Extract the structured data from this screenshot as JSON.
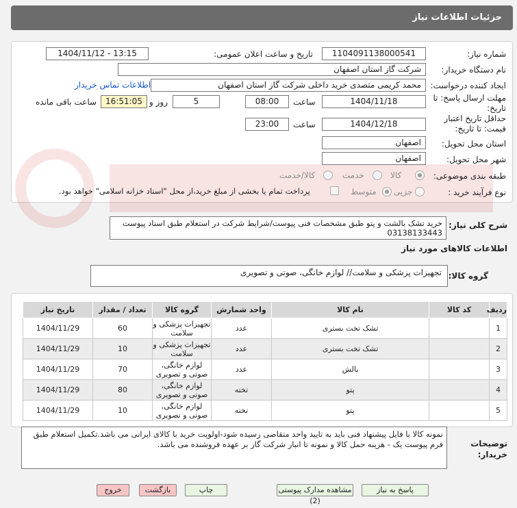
{
  "header": {
    "title": "جزئیات اطلاعات نیاز"
  },
  "form": {
    "need_number_label": "شماره نیاز:",
    "need_number": "1104091138000541",
    "announce_label": "تاریخ و ساعت اعلان عمومی:",
    "announce_value": "1404/11/12 - 13:15",
    "buyer_org_label": "نام دستگاه خریدار:",
    "buyer_org": "شرکت گاز استان اصفهان",
    "creator_label": "ایجاد کننده درخواست:",
    "creator": "محمد کریمی متصدی خرید داخلی شرکت گاز استان اصفهان",
    "contact_link": "اطلاعات تماس خریدار",
    "deadline_label": "مهلت ارسال پاسخ: تا تاریخ:",
    "deadline_date": "1404/11/18",
    "time_label": "ساعت",
    "deadline_time": "08:00",
    "days": "5",
    "days_label": "روز و",
    "remaining_time": "16:51:05",
    "remaining_label": "ساعت باقی مانده",
    "min_validity_label": "حداقل تاریخ اعتبار قیمت: تا تاریخ:",
    "validity_date": "1404/12/18",
    "validity_time": "23:00",
    "province_label": "استان محل تحویل:",
    "province": "اصفهان",
    "city_label": "شهر محل تحویل:",
    "city": "اصفهان",
    "category_label": "طبقه بندی موضوعی:",
    "category_options": [
      "کالا",
      "خدمت",
      "کالا/خدمت"
    ],
    "process_label": "نوع فرآیند خرید :",
    "process_options": [
      "جزیی",
      "متوسط"
    ],
    "payment_note": "پرداخت تمام یا بخشی از مبلغ خرید،از محل \"اسناد خزانه اسلامی\" خواهد بود."
  },
  "description": {
    "label": "شرح کلی نیاز:",
    "text": "خرید تشک بالشت و پتو طبق مشخصات فنی پیوست/شرایط شرکت در استعلام طبق اسناد پیوست 03138133443"
  },
  "goods_info_title": "اطلاعات کالاهای مورد نیاز",
  "goods_group": {
    "label": "گروه کالا:",
    "text": "تجهیزات پزشکی و سلامت// لوازم خانگی، صوتی و تصویری"
  },
  "table": {
    "headers": [
      "ردیف",
      "کد کالا",
      "نام کالا",
      "واحد شمارش",
      "گروه کالا",
      "تعداد / مقدار",
      "تاریخ نیاز"
    ],
    "rows": [
      {
        "row": "1",
        "code": "",
        "name": "تشک تخت بستری",
        "unit": "عدد",
        "group": "تجهیزات پزشکی و سلامت",
        "qty": "60",
        "date": "1404/11/29"
      },
      {
        "row": "2",
        "code": "",
        "name": "تشک تخت بستری",
        "unit": "عدد",
        "group": "تجهیزات پزشکی و سلامت",
        "qty": "10",
        "date": "1404/11/29"
      },
      {
        "row": "3",
        "code": "",
        "name": "بالش",
        "unit": "عدد",
        "group": "لوازم خانگی، صوتی و تصویری",
        "qty": "70",
        "date": "1404/11/29"
      },
      {
        "row": "4",
        "code": "",
        "name": "پتو",
        "unit": "تخته",
        "group": "لوازم خانگی، صوتی و تصویری",
        "qty": "80",
        "date": "1404/11/29"
      },
      {
        "row": "5",
        "code": "",
        "name": "پتو",
        "unit": "تخته",
        "group": "لوازم خانگی، صوتی و تصویری",
        "qty": "10",
        "date": "1404/11/29"
      }
    ]
  },
  "buyer_notes": {
    "label": "توضیحات خریدار:",
    "text": "نمونه کالا با فایل پیشنهاد فنی باید به تایید واحد متقاضی رسیده شود-اولویت خرید با کالای ایرانی می باشد.تکمیل استعلام طبق فرم پیوست یک - هزینه حمل کالا و نمونه تا انبار شرکت گاز بر عهده فروشنده می باشد."
  },
  "buttons": {
    "respond": "پاسخ به نیاز",
    "view_docs": "مشاهده مدارک پیوستی (2)",
    "print": "چاپ",
    "back": "بازگشت",
    "exit": "خروج"
  },
  "colors": {
    "header_bg": "#6c6c6c",
    "link": "#1a56c8",
    "btn_green": "#e8f5e1",
    "btn_pink": "#f8c5c5",
    "highlight": "#fdf7c8"
  }
}
